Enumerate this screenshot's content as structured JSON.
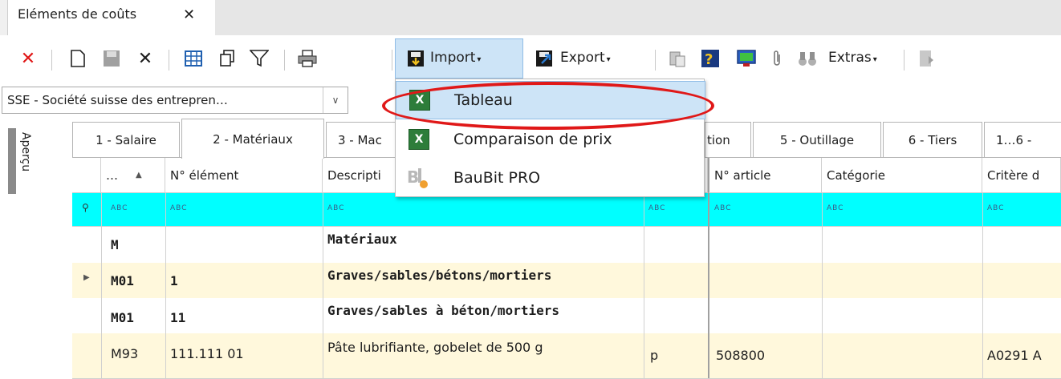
{
  "window_tab": {
    "title": "Eléments de coûts",
    "close": "✕"
  },
  "toolbar": {
    "import_label": "Import",
    "export_label": "Export",
    "extras_label": "Extras",
    "dropdown_arrow": "▾"
  },
  "combo": {
    "value": "SSE - Société suisse des entrepren…",
    "arrow": "∨"
  },
  "side_panel": {
    "label": "Aperçu"
  },
  "category_tabs": [
    "1 - Salaire",
    "2 - Matériaux",
    "3 - Mac",
    "tion",
    "5 - Outillage",
    "6 - Tiers",
    "1…6 -"
  ],
  "columns": [
    "…",
    "N° élément",
    "Descripti",
    "N° article",
    "Catégorie",
    "Critère d"
  ],
  "filter_placeholder": "ABC",
  "rows": [
    {
      "code": "M",
      "number": "",
      "description": "Matériaux",
      "unit": "",
      "article": "",
      "criteria": ""
    },
    {
      "code": "M01",
      "number": "1",
      "description": "Graves/sables/bétons/mortiers",
      "unit": "",
      "article": "",
      "criteria": ""
    },
    {
      "code": "M01",
      "number": "11",
      "description": "Graves/sables à béton/mortiers",
      "unit": "",
      "article": "",
      "criteria": ""
    },
    {
      "code": "M93",
      "number": "111.111 01",
      "description": "Pâte lubrifiante, gobelet de 500 g",
      "unit": "p",
      "article": "508800",
      "criteria": "A0291 A"
    }
  ],
  "import_menu": {
    "items": [
      {
        "label": "Tableau",
        "icon": "excel-icon",
        "highlighted": true
      },
      {
        "label": "Comparaison de prix",
        "icon": "excel-icon",
        "highlighted": false
      },
      {
        "label": "BauBit PRO",
        "icon": "baubit-icon",
        "highlighted": false
      }
    ]
  },
  "colors": {
    "filter_row": "#00ffff",
    "row_alt": "#fff8dc",
    "highlight_ring": "#e01818",
    "menu_highlight": "#cde4f7",
    "close_red": "#e01818"
  }
}
